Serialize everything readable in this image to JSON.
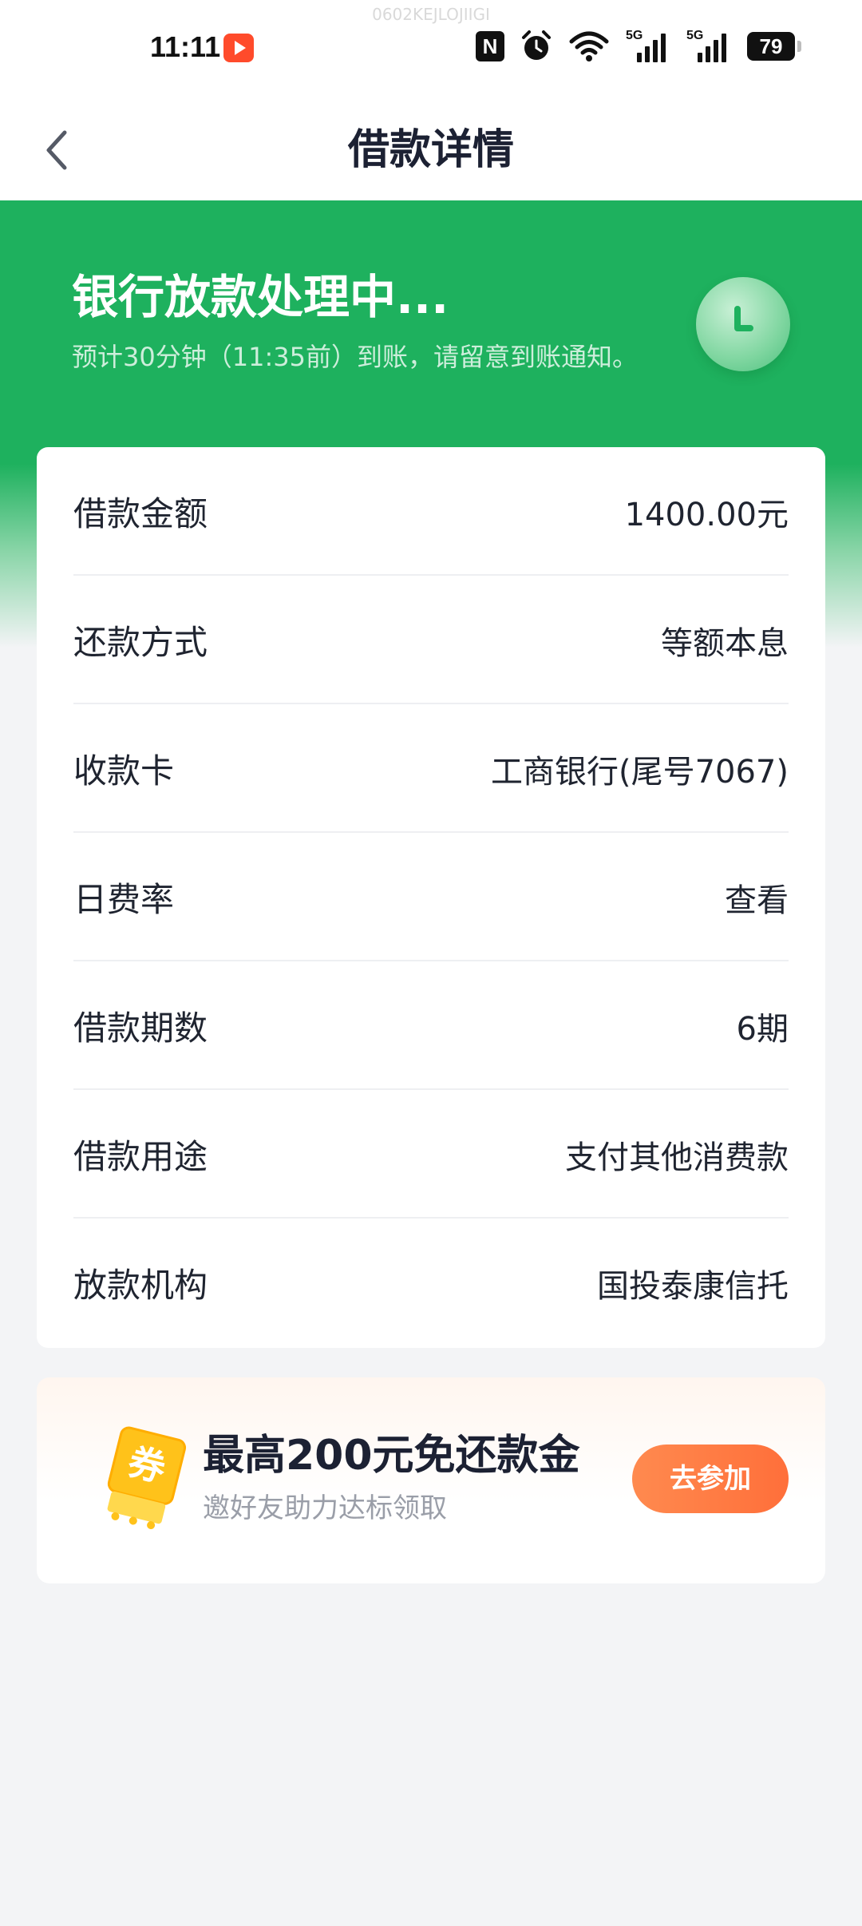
{
  "status_bar": {
    "watermark": "0602KEJLOJIIGI",
    "time": "11:11",
    "nfc_label": "N",
    "network_tag_1": "5G",
    "network_tag_2": "5G",
    "battery_level": "79"
  },
  "nav": {
    "title": "借款详情"
  },
  "banner": {
    "title": "银行放款处理中...",
    "subtitle": "预计30分钟（11:35前）到账，请留意到账通知。"
  },
  "details": {
    "rows": [
      {
        "label": "借款金额",
        "value": "1400.00元"
      },
      {
        "label": "还款方式",
        "value": "等额本息"
      },
      {
        "label": "收款卡",
        "value": "工商银行(尾号7067)"
      },
      {
        "label": "日费率",
        "value": "查看"
      },
      {
        "label": "借款期数",
        "value": "6期"
      },
      {
        "label": "借款用途",
        "value": "支付其他消费款"
      },
      {
        "label": "放款机构",
        "value": "国投泰康信托"
      }
    ]
  },
  "promo": {
    "title": "最高200元免还款金",
    "subtitle": "邀好友助力达标领取",
    "button_label": "去参加",
    "coupon_glyph": "券"
  },
  "colors": {
    "brand_green": "#1eb15e",
    "accent_orange": "#ff7a45"
  }
}
